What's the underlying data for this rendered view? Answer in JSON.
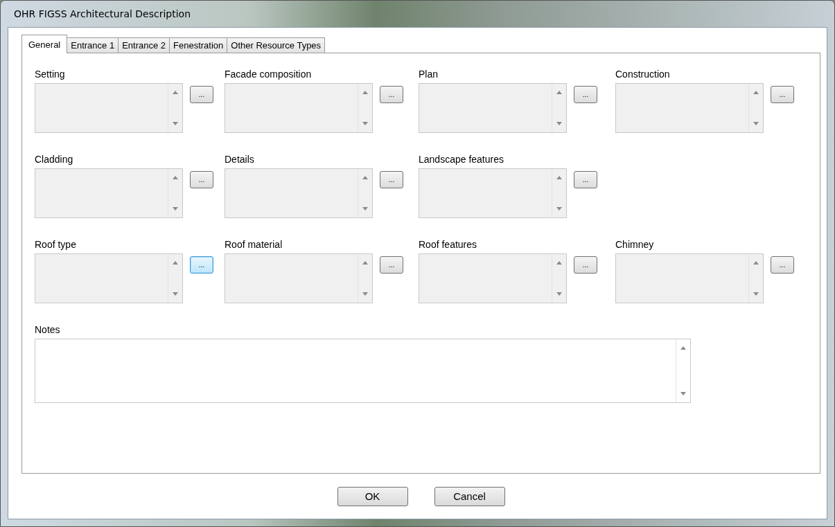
{
  "window": {
    "title": "OHR FIGSS Architectural Description"
  },
  "tabs": [
    {
      "label": "General",
      "selected": true
    },
    {
      "label": "Entrance 1",
      "selected": false
    },
    {
      "label": "Entrance 2",
      "selected": false
    },
    {
      "label": "Fenestration",
      "selected": false
    },
    {
      "label": "Other Resource Types",
      "selected": false
    }
  ],
  "field_rows": [
    [
      {
        "label": "Setting",
        "disabled": true,
        "button": "...",
        "focused": false
      },
      {
        "label": "Facade composition",
        "disabled": true,
        "button": "...",
        "focused": false
      },
      {
        "label": "Plan",
        "disabled": true,
        "button": "...",
        "focused": false
      },
      {
        "label": "Construction",
        "disabled": true,
        "button": "...",
        "focused": false
      }
    ],
    [
      {
        "label": "Cladding",
        "disabled": true,
        "button": "...",
        "focused": false
      },
      {
        "label": "Details",
        "disabled": true,
        "button": "...",
        "focused": false
      },
      {
        "label": "Landscape features",
        "disabled": true,
        "button": "...",
        "focused": false
      }
    ],
    [
      {
        "label": "Roof type",
        "disabled": true,
        "button": "...",
        "focused": true
      },
      {
        "label": "Roof material",
        "disabled": true,
        "button": "...",
        "focused": false
      },
      {
        "label": "Roof features",
        "disabled": true,
        "button": "...",
        "focused": false
      },
      {
        "label": "Chimney",
        "disabled": true,
        "button": "...",
        "focused": false
      }
    ]
  ],
  "notes": {
    "label": "Notes",
    "disabled": false
  },
  "buttons": [
    "OK",
    "Cancel"
  ]
}
